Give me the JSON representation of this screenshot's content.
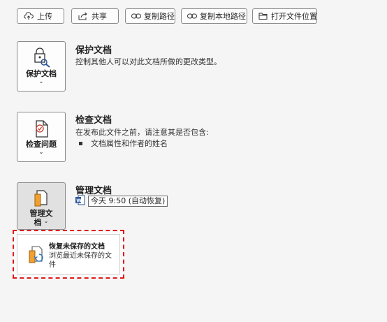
{
  "toolbar": {
    "upload": "上传",
    "share": "共享",
    "copy_path": "复制路径",
    "copy_local_path": "复制本地路径",
    "open_location": "打开文件位置"
  },
  "protect": {
    "button_label": "保护文档",
    "title": "保护文档",
    "description": "控制其他人可以对此文档所做的更改类型。"
  },
  "inspect": {
    "button_label": "检查问题",
    "title": "检查文档",
    "description": "在发布此文件之前，请注意其是否包含:",
    "bullets": [
      "文档属性和作者的姓名"
    ]
  },
  "manage": {
    "button_label_line1": "管理文",
    "button_label_line2": "档",
    "title": "管理文档",
    "version_entry": "今天 9:50 (自动恢复)"
  },
  "dropdown": {
    "item_title": "恢复未保存的文档",
    "item_desc": "浏览最近未保存的文件"
  },
  "colors": {
    "accent_blue": "#2b579a",
    "highlight_red": "#e01919",
    "folder_orange": "#f0a030"
  }
}
